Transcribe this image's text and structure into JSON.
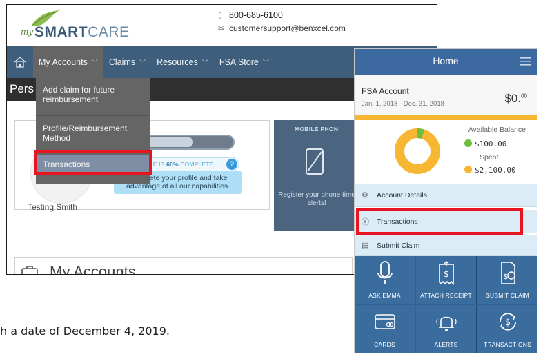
{
  "desktop": {
    "logo": {
      "prefix": "my",
      "brand": "SMART",
      "brand2": "CARE"
    },
    "contact": {
      "phone": "800-685-6100",
      "email": "customersupport@benxcel.com"
    },
    "nav": {
      "items": [
        {
          "label": "My Accounts",
          "active": true
        },
        {
          "label": "Claims"
        },
        {
          "label": "Resources"
        },
        {
          "label": "FSA Store"
        }
      ]
    },
    "page_title": "Pers",
    "dropdown": [
      {
        "label": "Add claim for future reimbursement"
      },
      {
        "label": "Profile/Reimbursement Method"
      },
      {
        "label": "Transactions",
        "selected": true
      }
    ],
    "profile": {
      "name": "Testing Smith",
      "progress_percent": 60,
      "complete_prefix": "OFILE IS",
      "complete_percent": "60%",
      "complete_suffix": "COMPLETE",
      "help_glyph": "?",
      "prompt": "Complete your profile and take advantage of all our capabilities."
    },
    "mobile_panel": {
      "title": "MOBILE PHON",
      "text": "Register your phone time alerts!"
    },
    "accounts_title": "My Accounts"
  },
  "mobile": {
    "title": "Home",
    "fsa": {
      "title": "FSA Account",
      "dates": "Jan. 1, 2018 - Dec. 31, 2018",
      "amount": "$0.",
      "amount_cents": "00"
    },
    "balance": {
      "available_label": "Available Balance",
      "available_value": "$100.00",
      "spent_label": "Spent",
      "spent_value": "$2,100.00",
      "available_fraction": 0.05
    },
    "list": [
      {
        "label": "Account Details",
        "icon": "gauge-icon"
      },
      {
        "label": "Transactions",
        "icon": "dollar-circle-icon"
      },
      {
        "label": "Submit Claim",
        "icon": "document-icon"
      }
    ],
    "tiles": [
      {
        "label": "ASK EMMA",
        "icon": "microphone-icon"
      },
      {
        "label": "ATTACH RECEIPT",
        "icon": "receipt-icon"
      },
      {
        "label": "SUBMIT CLAIM",
        "icon": "claim-icon"
      },
      {
        "label": "CARDS",
        "icon": "card-icon"
      },
      {
        "label": "ALERTS",
        "icon": "bell-icon"
      },
      {
        "label": "TRANSACTIONS",
        "icon": "dollar-cycle-icon"
      }
    ]
  },
  "colors": {
    "nav_blue": "#3f5e7c",
    "highlight_red": "#e8141f",
    "gold": "#f7b733",
    "green_dot": "#6dbd3e",
    "mobile_blue": "#3c6aa0"
  },
  "caption": "h a date of December 4, 2019."
}
